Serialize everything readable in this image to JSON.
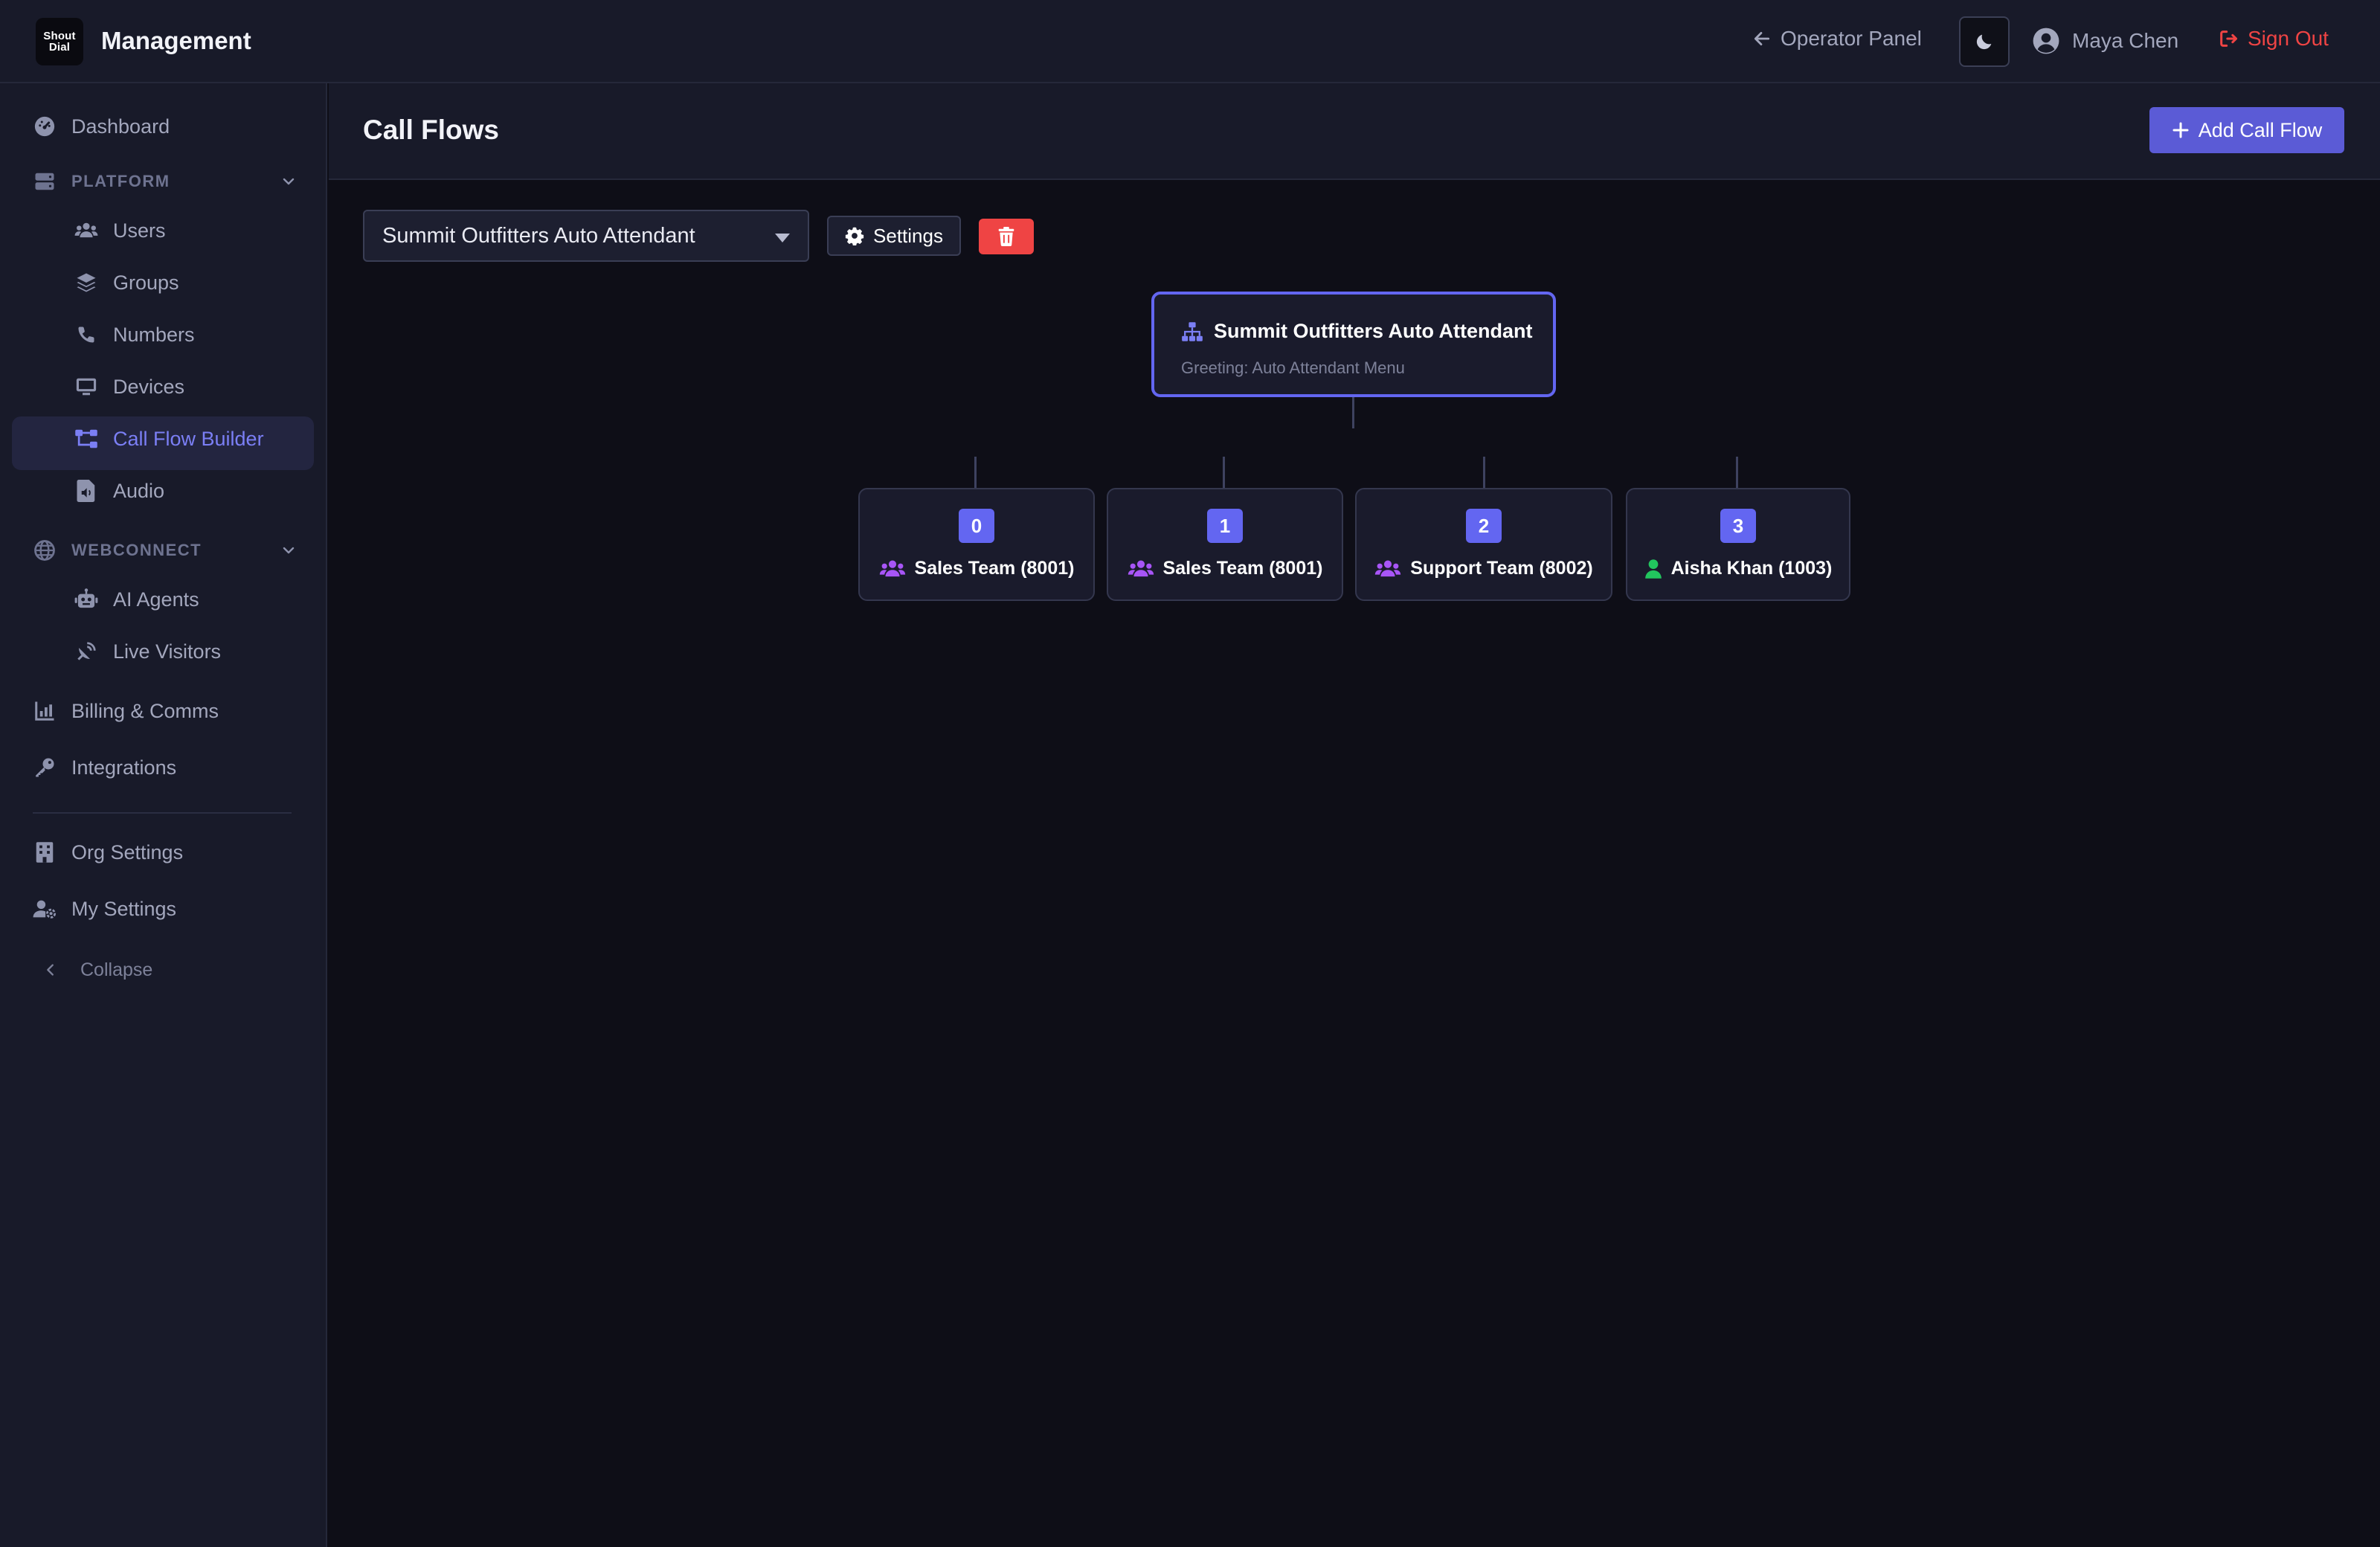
{
  "header": {
    "logo_line1": "Shout",
    "logo_line2": "Dial",
    "app_title": "Management",
    "operator_panel": "Operator Panel",
    "user_name": "Maya Chen",
    "sign_out": "Sign Out"
  },
  "sidebar": {
    "dashboard": "Dashboard",
    "platform_section": "PLATFORM",
    "platform_items": [
      "Users",
      "Groups",
      "Numbers",
      "Devices",
      "Call Flow Builder",
      "Audio"
    ],
    "active_item": "Call Flow Builder",
    "webconnect_section": "WEBCONNECT",
    "webconnect_items": [
      "AI Agents",
      "Live Visitors"
    ],
    "billing": "Billing & Comms",
    "integrations": "Integrations",
    "org_settings": "Org Settings",
    "my_settings": "My Settings",
    "collapse": "Collapse"
  },
  "page": {
    "title": "Call Flows",
    "add_button": "Add Call Flow",
    "selected_flow": "Summit Outfitters Auto Attendant",
    "settings_button": "Settings"
  },
  "flow": {
    "root": {
      "title": "Summit Outfitters Auto Attendant",
      "greeting": "Greeting: Auto Attendant Menu"
    },
    "branches": [
      {
        "digit": "0",
        "target": "Sales Team (8001)",
        "type": "group"
      },
      {
        "digit": "1",
        "target": "Sales Team (8001)",
        "type": "group"
      },
      {
        "digit": "2",
        "target": "Support Team (8002)",
        "type": "group"
      },
      {
        "digit": "3",
        "target": "Aisha Khan (1003)",
        "type": "user"
      }
    ]
  },
  "colors": {
    "accent": "#6366f1",
    "accent_button": "#5b5bd6",
    "danger": "#ef4444",
    "group_icon": "#a855f7",
    "user_icon": "#22c55e",
    "background": "#0e0e17",
    "panel": "#181a29"
  },
  "icons": {
    "operator_panel": "arrow-left-icon",
    "theme": "moon-icon",
    "user": "user-circle-icon",
    "sign_out": "sign-out-icon",
    "add": "plus-icon",
    "settings": "gear-icon",
    "delete": "trash-icon",
    "root": "sitemap-icon",
    "group": "users-icon",
    "user_target": "user-icon"
  }
}
